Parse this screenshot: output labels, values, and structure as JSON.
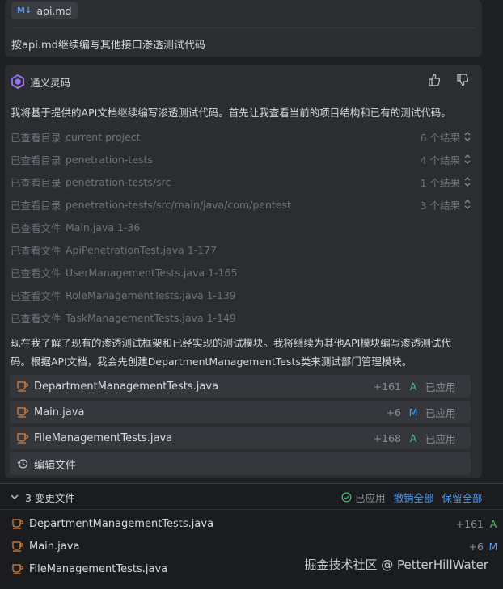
{
  "user_message": {
    "attachment_badge": "M↓",
    "attachment_name": "api.md",
    "text": "按api.md继续编写其他接口渗透测试代码"
  },
  "assistant": {
    "name": "通义灵码",
    "intro": "我将基于提供的API文档继续编写渗透测试代码。首先让我查看当前的项目结构和已有的测试代码。",
    "steps": [
      {
        "kind": "已查看目录",
        "path": "current project",
        "count": "6 个结果"
      },
      {
        "kind": "已查看目录",
        "path": "penetration-tests",
        "count": "4 个结果"
      },
      {
        "kind": "已查看目录",
        "path": "penetration-tests/src",
        "count": "1 个结果"
      },
      {
        "kind": "已查看目录",
        "path": "penetration-tests/src/main/java/com/pentest",
        "count": "3 个结果"
      },
      {
        "kind": "已查看文件",
        "path": "Main.java 1-36",
        "count": ""
      },
      {
        "kind": "已查看文件",
        "path": "ApiPenetrationTest.java 1-177",
        "count": ""
      },
      {
        "kind": "已查看文件",
        "path": "UserManagementTests.java 1-165",
        "count": ""
      },
      {
        "kind": "已查看文件",
        "path": "RoleManagementTests.java 1-139",
        "count": ""
      },
      {
        "kind": "已查看文件",
        "path": "TaskManagementTests.java 1-149",
        "count": ""
      }
    ],
    "summary_line1": "现在我了解了现有的渗透测试框架和已经实现的测试模块。我将继续为其他API模块编写渗透测试代",
    "summary_line2": "码。根据API文档，我会先创建DepartmentManagementTests类来测试部门管理模块。",
    "files": [
      {
        "name": "DepartmentManagementTests.java",
        "delta": "+161",
        "status": "A",
        "applied": "已应用"
      },
      {
        "name": "Main.java",
        "delta": "+6",
        "status": "M",
        "applied": "已应用"
      },
      {
        "name": "FileManagementTests.java",
        "delta": "+168",
        "status": "A",
        "applied": "已应用"
      }
    ],
    "edit_files_label": "编辑文件"
  },
  "changes_panel": {
    "title": "3 变更文件",
    "applied_label": "已应用",
    "undo_all": "撤销全部",
    "keep_all": "保留全部",
    "files": [
      {
        "name": "DepartmentManagementTests.java",
        "delta": "+161",
        "status": "A"
      },
      {
        "name": "Main.java",
        "delta": "+6",
        "status": "M"
      },
      {
        "name": "FileManagementTests.java",
        "delta": "",
        "status": ""
      }
    ]
  },
  "watermark": "掘金技术社区 @ PetterHillWater",
  "colors": {
    "added": "#4fbf77",
    "modified": "#5aa0f0",
    "link": "#4b9cf5",
    "accent_cup": "#d9823b"
  }
}
